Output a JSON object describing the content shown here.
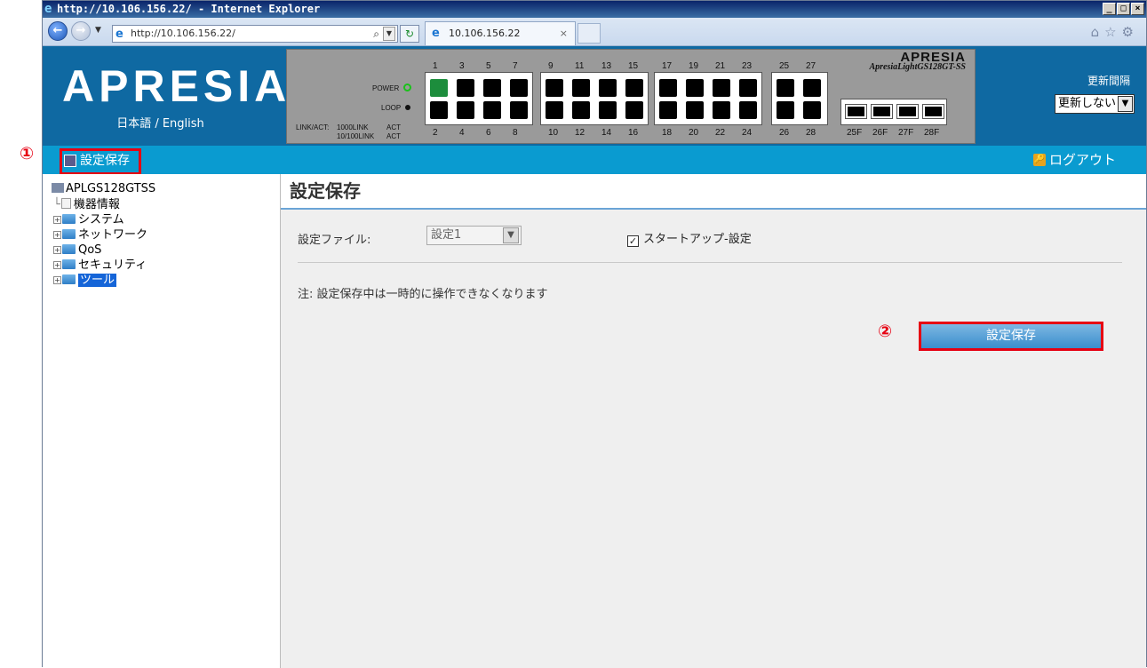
{
  "browser": {
    "title": "http://10.106.156.22/ - Internet Explorer",
    "address": "http://10.106.156.22/",
    "tab_label": "10.106.156.22"
  },
  "header": {
    "logo": "APRESIA",
    "language": "日本語 / English",
    "panel_brand": "APRESIA",
    "panel_model": "ApresiaLightGS128GT-SS",
    "power_label": "POWER",
    "loop_label": "LOOP",
    "legend_link_act": "LINK/ACT:",
    "legend_1000": "1000LINK",
    "legend_10_100": "10/100LINK",
    "legend_act": "ACT",
    "ports_top": [
      "1",
      "3",
      "5",
      "7",
      "9",
      "11",
      "13",
      "15",
      "17",
      "19",
      "21",
      "23",
      "25",
      "27"
    ],
    "ports_bottom": [
      "2",
      "4",
      "6",
      "8",
      "10",
      "12",
      "14",
      "16",
      "18",
      "20",
      "22",
      "24",
      "26",
      "28"
    ],
    "sfp_ports": [
      "25F",
      "26F",
      "27F",
      "28F"
    ],
    "interval_label": "更新間隔",
    "interval_value": "更新しない"
  },
  "menubar": {
    "save_label": "設定保存",
    "logout_label": "ログアウト"
  },
  "tree": {
    "root": "APLGS128GTSS",
    "items": [
      "機器情報",
      "システム",
      "ネットワーク",
      "QoS",
      "セキュリティ",
      "ツール"
    ]
  },
  "content": {
    "title": "設定保存",
    "file_label": "設定ファイル:",
    "file_value": "設定1",
    "startup_label": "スタートアップ-設定",
    "startup_checked": true,
    "note": "注: 設定保存中は一時的に操作できなくなります",
    "save_button": "設定保存"
  },
  "annotations": {
    "marker1": "①",
    "marker2": "②"
  },
  "colors": {
    "header": "#0f69a2",
    "menubar": "#0a9bd0",
    "highlight": "#e60012"
  }
}
